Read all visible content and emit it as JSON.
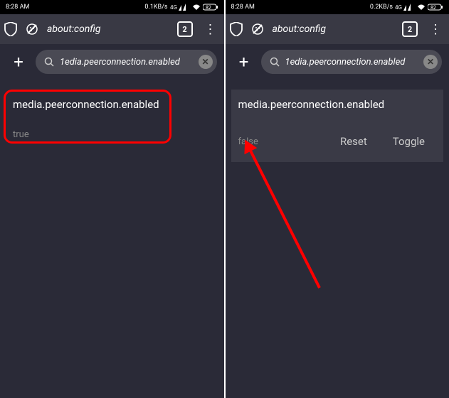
{
  "statusBar": {
    "time": "8:28 AM",
    "net1": "0.1KB/s",
    "net2": "0.2KB/s",
    "battery": "82"
  },
  "toolbar": {
    "url": "about:config",
    "tabCount": "2"
  },
  "search": {
    "placeholder": "1edia.peerconnection.enabled"
  },
  "pref": {
    "name": "media.peerconnection.enabled",
    "valueLeft": "true",
    "valueRight": "false",
    "resetLabel": "Reset",
    "toggleLabel": "Toggle"
  },
  "addLabel": "+"
}
